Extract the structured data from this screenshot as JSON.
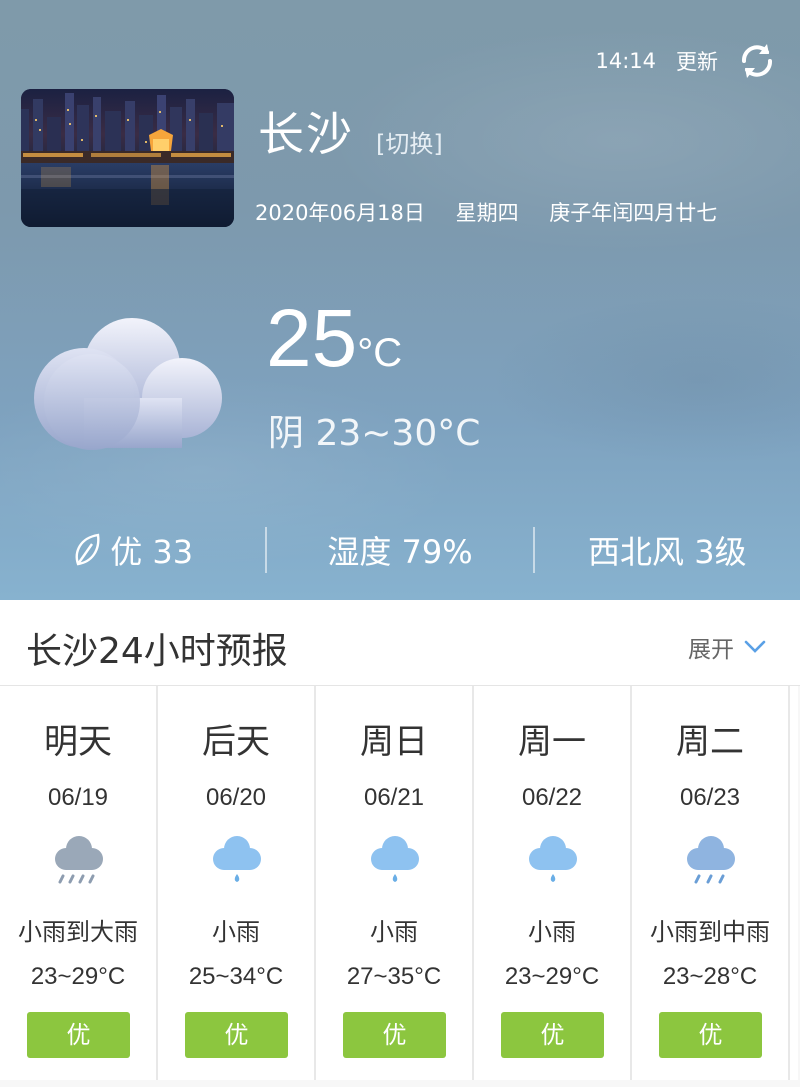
{
  "top": {
    "time": "14:14",
    "update_label": "更新"
  },
  "city": {
    "name": "长沙",
    "switch_label": "[切换]"
  },
  "date": {
    "solar": "2020年06月18日",
    "weekday": "星期四",
    "lunar": "庚子年闰四月廿七"
  },
  "current": {
    "temp": "25",
    "unit": "°C",
    "condition_range": "阴 23~30°C",
    "icon": "cloud-icon"
  },
  "stats": {
    "aqi": "优 33",
    "humidity": "湿度 79%",
    "wind": "西北风 3级"
  },
  "forecast": {
    "title": "长沙24小时预报",
    "expand_label": "展开",
    "days": [
      {
        "day": "明天",
        "date": "06/19",
        "icon": "heavy-rain-icon",
        "desc": "小雨到大雨",
        "temp": "23~29°C",
        "aqi": "优"
      },
      {
        "day": "后天",
        "date": "06/20",
        "icon": "light-rain-icon",
        "desc": "小雨",
        "temp": "25~34°C",
        "aqi": "优"
      },
      {
        "day": "周日",
        "date": "06/21",
        "icon": "light-rain-icon",
        "desc": "小雨",
        "temp": "27~35°C",
        "aqi": "优"
      },
      {
        "day": "周一",
        "date": "06/22",
        "icon": "light-rain-icon",
        "desc": "小雨",
        "temp": "23~29°C",
        "aqi": "优"
      },
      {
        "day": "周二",
        "date": "06/23",
        "icon": "moderate-rain-icon",
        "desc": "小雨到中雨",
        "temp": "23~28°C",
        "aqi": "优"
      }
    ]
  },
  "colors": {
    "aqi_good": "#8cc63f",
    "rain_icon_blue": "#8ec2f0",
    "heavy_rain_gray": "#9aa8b8"
  }
}
